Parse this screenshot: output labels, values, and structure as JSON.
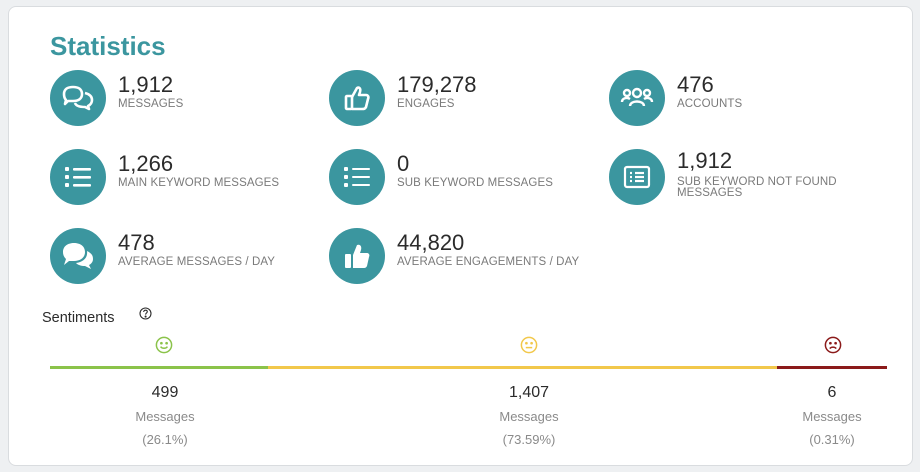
{
  "title": "Statistics",
  "colors": {
    "accent": "#3b969f",
    "positive": "#8bc34a",
    "neutral": "#f2c84b",
    "negative": "#8b1a1a"
  },
  "stats": [
    {
      "value": "1,912",
      "label": "MESSAGES",
      "icon": "chat-bubbles-icon"
    },
    {
      "value": "179,278",
      "label": "ENGAGES",
      "icon": "thumbs-up-icon"
    },
    {
      "value": "476",
      "label": "ACCOUNTS",
      "icon": "users-group-icon"
    },
    {
      "value": "1,266",
      "label": "MAIN KEYWORD MESSAGES",
      "icon": "list-icon"
    },
    {
      "value": "0",
      "label": "SUB KEYWORD MESSAGES",
      "icon": "list-icon"
    },
    {
      "value": "1,912",
      "label": "SUB KEYWORD NOT FOUND MESSAGES",
      "icon": "list-box-icon"
    },
    {
      "value": "478",
      "label": "AVERAGE MESSAGES / DAY",
      "icon": "chat-solid-icon"
    },
    {
      "value": "44,820",
      "label": "AVERAGE ENGAGEMENTS / DAY",
      "icon": "thumbs-up-solid-icon"
    }
  ],
  "sentiments": {
    "title": "Sentiments",
    "help_icon": "question-circle-icon",
    "items": [
      {
        "name": "positive",
        "count": "499",
        "label": "Messages",
        "percent": "(26.1%)",
        "share": 26.1,
        "icon": "smile-icon"
      },
      {
        "name": "neutral",
        "count": "1,407",
        "label": "Messages",
        "percent": "(73.59%)",
        "share": 73.59,
        "icon": "neutral-face-icon"
      },
      {
        "name": "negative",
        "count": "6",
        "label": "Messages",
        "percent": "(0.31%)",
        "share": 0.31,
        "icon": "frown-icon"
      }
    ]
  }
}
